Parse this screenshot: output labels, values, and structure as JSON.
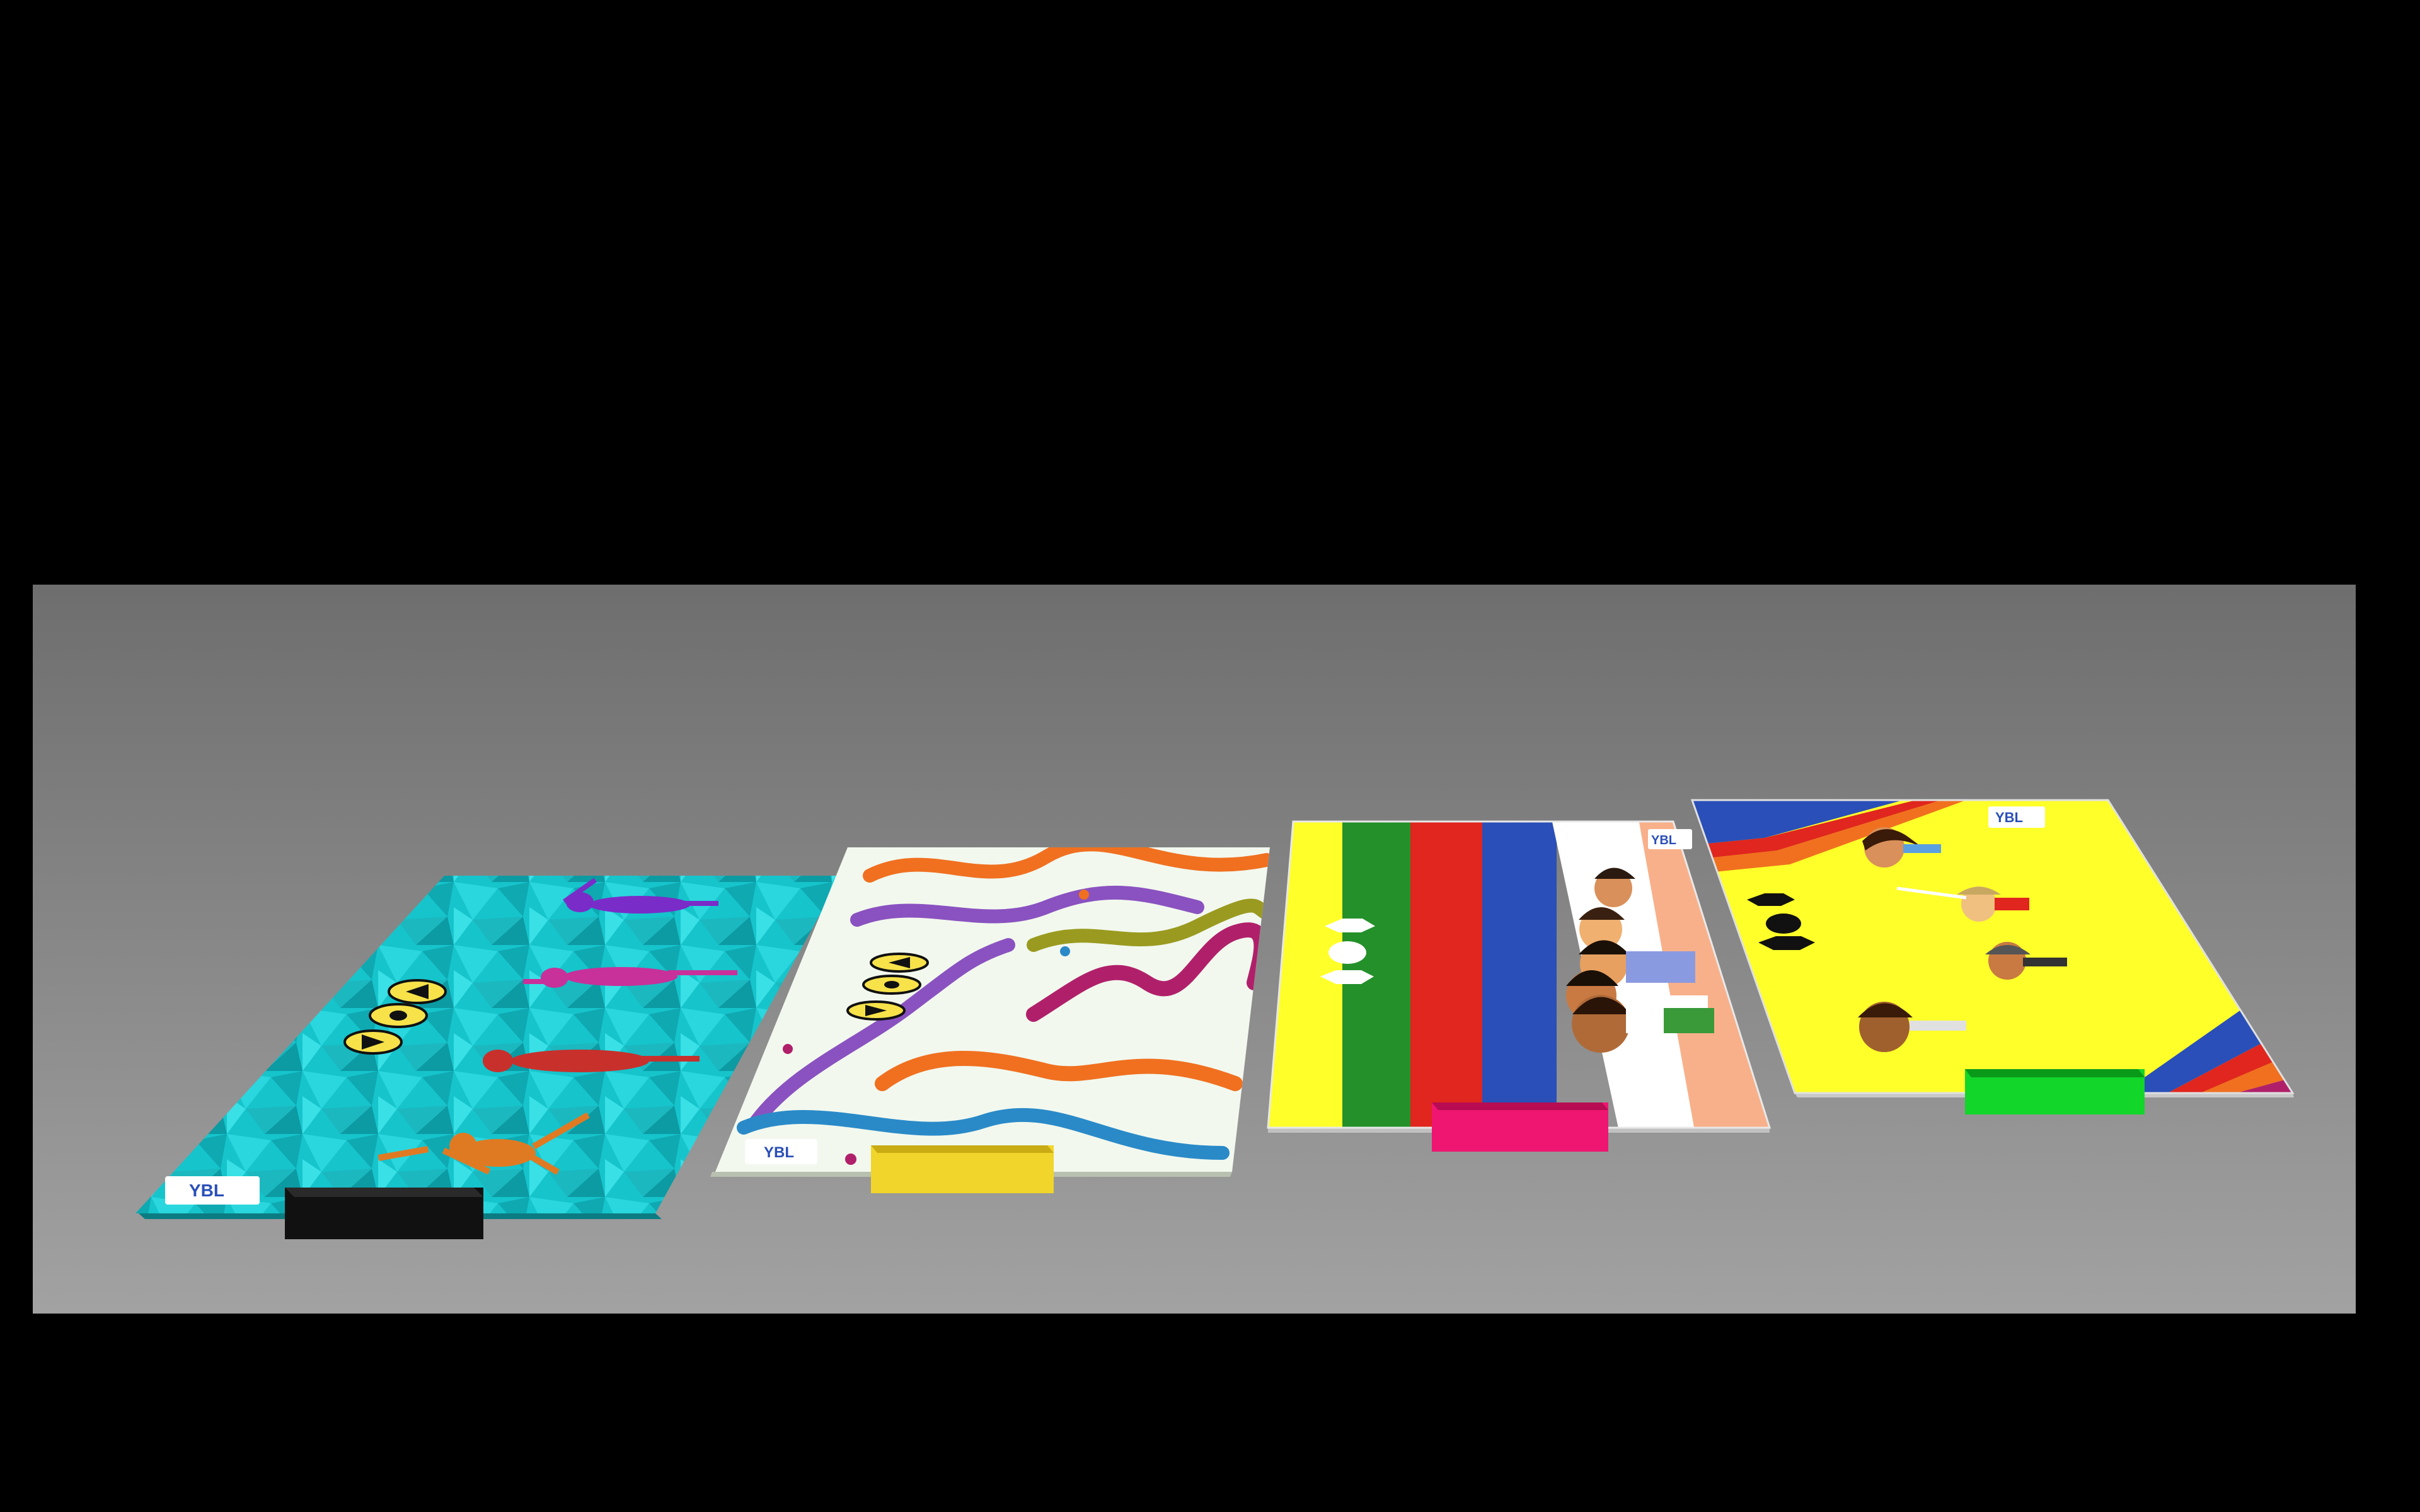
{
  "scene": {
    "background_color": "#000000",
    "floor_color_top": "#6e6e6e",
    "floor_color_bottom": "#a2a2a2"
  },
  "mats": [
    {
      "name": "teal-polygon-mat",
      "theme": "swimming figures on teal low-poly water",
      "base_color": "#16c4cc",
      "handle_color": "#111111",
      "figure_colors": [
        "#7a2cc8",
        "#c8309a",
        "#c8302c",
        "#e07a22"
      ]
    },
    {
      "name": "squiggle-mat",
      "theme": "colorful squiggly lines on white",
      "base_color": "#f2f8ee",
      "handle_color": "#f2d52a",
      "line_colors": [
        "#f07020",
        "#8a52c0",
        "#9a9a20",
        "#b0206a",
        "#2a8ac8"
      ]
    },
    {
      "name": "stripes-mat",
      "theme": "vertical color stripes with cartoon kids",
      "stripe_colors": [
        "#ffff2a",
        "#23902a",
        "#e0261e",
        "#2a4fb8",
        "#ffffff",
        "#f8b08a"
      ],
      "handle_color": "#ee1670"
    },
    {
      "name": "yellow-kids-mat",
      "theme": "yellow mat with cartoon children and rainbow corners",
      "base_color": "#ffff2a",
      "handle_color": "#12d62a",
      "rainbow_colors": [
        "#2a4fb8",
        "#e0261e",
        "#f07020",
        "#b0206a"
      ]
    }
  ],
  "logo": {
    "text": "YBL"
  }
}
